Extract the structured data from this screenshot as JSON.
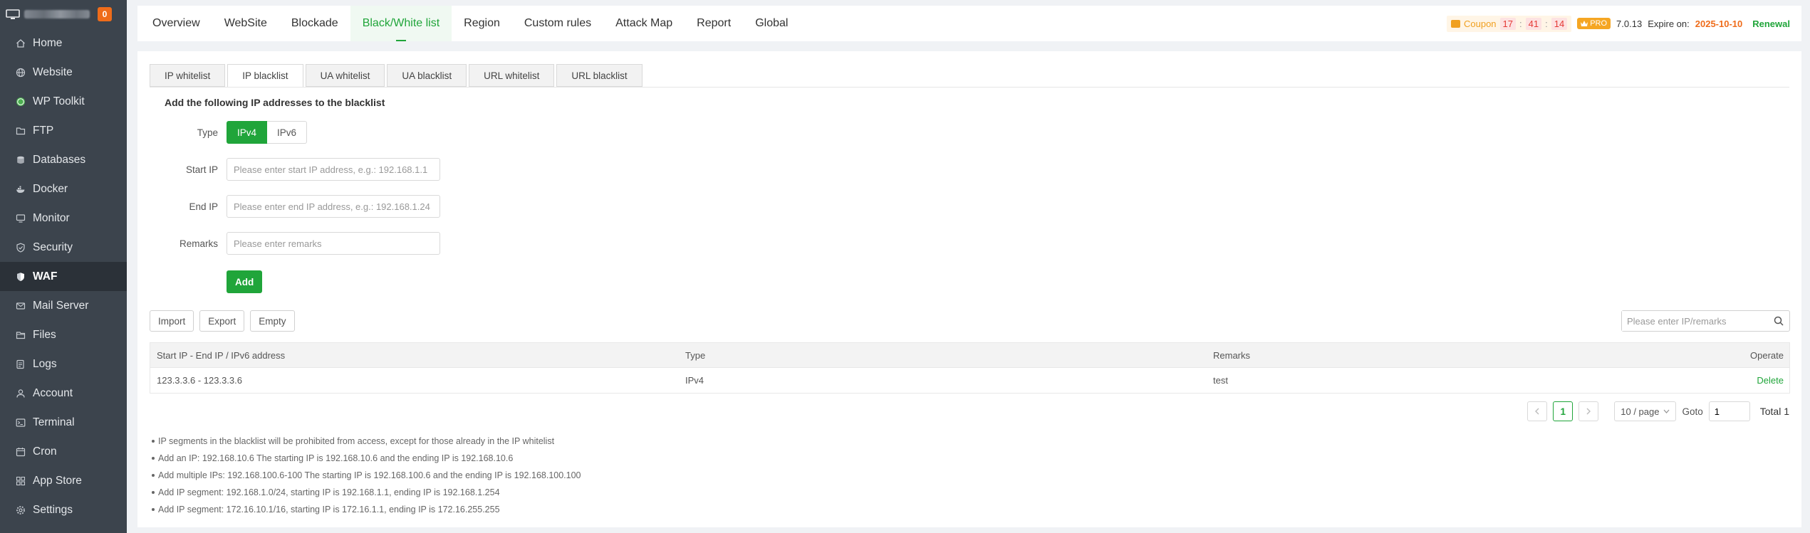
{
  "sidebar": {
    "badge": "0",
    "items": [
      {
        "label": "Home",
        "icon": "home-icon"
      },
      {
        "label": "Website",
        "icon": "globe-icon"
      },
      {
        "label": "WP Toolkit",
        "icon": "wordpress-icon"
      },
      {
        "label": "FTP",
        "icon": "folder-icon"
      },
      {
        "label": "Databases",
        "icon": "database-icon"
      },
      {
        "label": "Docker",
        "icon": "docker-icon"
      },
      {
        "label": "Monitor",
        "icon": "monitor-icon"
      },
      {
        "label": "Security",
        "icon": "shield-icon"
      },
      {
        "label": "WAF",
        "icon": "waf-shield-icon"
      },
      {
        "label": "Mail Server",
        "icon": "mail-icon"
      },
      {
        "label": "Files",
        "icon": "files-icon"
      },
      {
        "label": "Logs",
        "icon": "logs-icon"
      },
      {
        "label": "Account",
        "icon": "user-icon"
      },
      {
        "label": "Terminal",
        "icon": "terminal-icon"
      },
      {
        "label": "Cron",
        "icon": "calendar-icon"
      },
      {
        "label": "App Store",
        "icon": "appstore-icon"
      },
      {
        "label": "Settings",
        "icon": "gear-icon"
      }
    ],
    "active": "WAF"
  },
  "topnav": {
    "tabs": [
      "Overview",
      "WebSite",
      "Blockade",
      "Black/White list",
      "Region",
      "Custom rules",
      "Attack Map",
      "Report",
      "Global"
    ],
    "active_tab": "Black/White list",
    "coupon_label": "Coupon",
    "countdown": {
      "h": "17",
      "m": "41",
      "s": "14"
    },
    "pro_label": "PRO",
    "version": "7.0.13",
    "expire_label": "Expire on:",
    "expire_date": "2025-10-10",
    "renewal": "Renewal"
  },
  "subtabs": [
    "IP whitelist",
    "IP blacklist",
    "UA whitelist",
    "UA blacklist",
    "URL whitelist",
    "URL blacklist"
  ],
  "active_subtab": "IP blacklist",
  "form": {
    "title": "Add the following IP addresses to the blacklist",
    "type_label": "Type",
    "type_options": [
      "IPv4",
      "IPv6"
    ],
    "type_selected": "IPv4",
    "start_label": "Start IP",
    "start_placeholder": "Please enter start IP address, e.g.: 192.168.1.1",
    "end_label": "End IP",
    "end_placeholder": "Please enter end IP address, e.g.: 192.168.1.24",
    "remarks_label": "Remarks",
    "remarks_placeholder": "Please enter remarks",
    "add_button": "Add"
  },
  "toolbar": {
    "import": "Import",
    "export": "Export",
    "empty": "Empty",
    "search_placeholder": "Please enter IP/remarks"
  },
  "table": {
    "headers": [
      "Start IP - End IP / IPv6 address",
      "Type",
      "Remarks",
      "Operate"
    ],
    "rows": [
      {
        "range": "123.3.3.6 - 123.3.3.6",
        "type": "IPv4",
        "remarks": "test",
        "action": "Delete"
      }
    ]
  },
  "pagination": {
    "current": "1",
    "page_size": "10 / page",
    "goto_label": "Goto",
    "goto_value": "1",
    "total": "Total 1"
  },
  "notes": [
    "IP segments in the blacklist will be prohibited from access, except for those already in the IP whitelist",
    "Add an IP: 192.168.10.6 The starting IP is 192.168.10.6 and the ending IP is 192.168.10.6",
    "Add multiple IPs: 192.168.100.6-100 The starting IP is 192.168.100.6 and the ending IP is 192.168.100.100",
    "Add IP segment: 192.168.1.0/24, starting IP is 192.168.1.1, ending IP is 192.168.1.254",
    "Add IP segment: 172.16.10.1/16, starting IP is 172.16.1.1, ending IP is 172.16.255.255"
  ],
  "colors": {
    "accent": "#20a53a",
    "sidebar": "#3c444d",
    "warning": "#ef6c1a"
  }
}
